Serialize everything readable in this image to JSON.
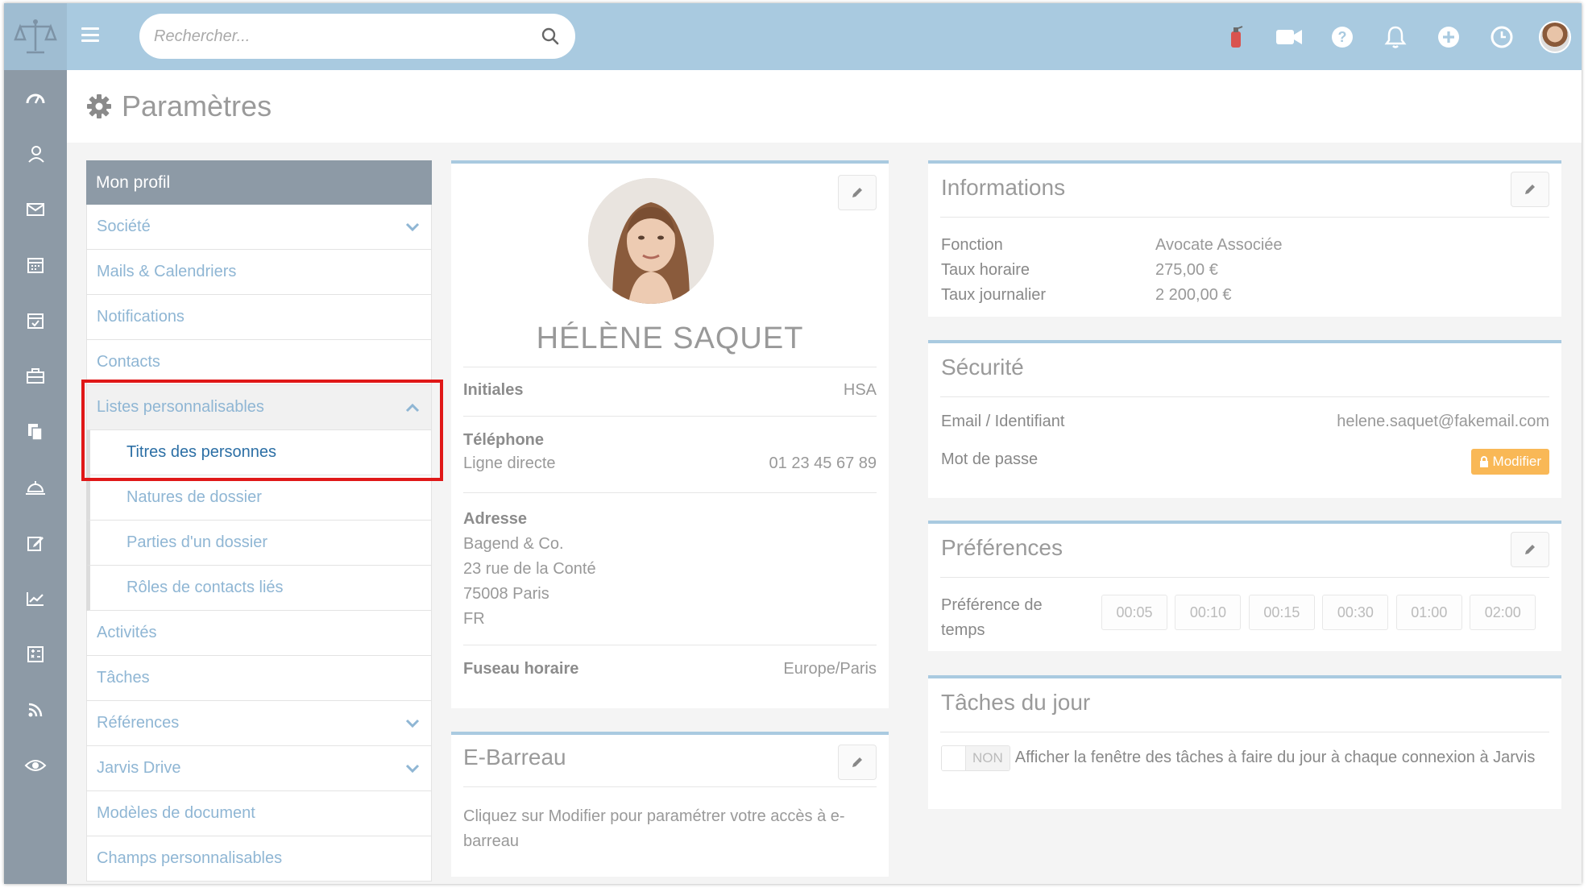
{
  "search": {
    "placeholder": "Rechercher..."
  },
  "page": {
    "title": "Paramètres"
  },
  "menu": {
    "header": "Mon profil",
    "items": [
      {
        "label": "Société",
        "chevron": "down"
      },
      {
        "label": "Mails & Calendriers"
      },
      {
        "label": "Notifications"
      },
      {
        "label": "Contacts"
      },
      {
        "label": "Listes personnalisables",
        "chevron": "up"
      }
    ],
    "subitems": [
      "Titres des personnes",
      "Natures de dossier",
      "Parties d'un dossier",
      "Rôles de contacts liés"
    ],
    "items_after": [
      {
        "label": "Activités"
      },
      {
        "label": "Tâches"
      },
      {
        "label": "Références",
        "chevron": "down"
      },
      {
        "label": "Jarvis Drive",
        "chevron": "down"
      },
      {
        "label": "Modèles de document"
      },
      {
        "label": "Champs personnalisables"
      }
    ]
  },
  "profile": {
    "name": "HÉLÈNE SAQUET",
    "initials_label": "Initiales",
    "initials_value": "HSA",
    "phone_label": "Téléphone",
    "phone_sub_label": "Ligne directe",
    "phone_value": "01 23 45 67 89",
    "address_label": "Adresse",
    "address_lines": [
      "Bagend & Co.",
      "23 rue de la Conté",
      "75008 Paris",
      "FR"
    ],
    "timezone_label": "Fuseau horaire",
    "timezone_value": "Europe/Paris"
  },
  "ebarreau": {
    "title": "E-Barreau",
    "text": "Cliquez sur Modifier pour paramétrer votre accès à e-barreau"
  },
  "informations": {
    "title": "Informations",
    "rows": [
      {
        "label": "Fonction",
        "value": "Avocate Associée"
      },
      {
        "label": "Taux horaire",
        "value": "275,00 €"
      },
      {
        "label": "Taux journalier",
        "value": "2 200,00 €"
      }
    ]
  },
  "securite": {
    "title": "Sécurité",
    "email_label": "Email / Identifiant",
    "email_value": "helene.saquet@fakemail.com",
    "password_label": "Mot de passe",
    "modify_label": "Modifier"
  },
  "preferences": {
    "title": "Préférences",
    "time_label_1": "Préférence de",
    "time_label_2": "temps",
    "times": [
      "00:05",
      "00:10",
      "00:15",
      "00:30",
      "01:00",
      "02:00"
    ]
  },
  "taches": {
    "title": "Tâches du jour",
    "toggle_label": "NON",
    "text": "Afficher la fenêtre des tâches à faire du jour à chaque connexion à Jarvis"
  },
  "colors": {
    "topbar": "#a9cae0",
    "sidebar": "#8d9aa6",
    "link": "#8fb6d4",
    "selected_link": "#2c6fa5",
    "highlight": "#e01818",
    "modify_button": "#f9b856"
  },
  "icons": {
    "logo": "scales-of-justice-icon",
    "top": [
      "extinguisher-icon",
      "video-camera-icon",
      "help-icon",
      "bell-icon",
      "plus-circle-icon",
      "clock-icon"
    ],
    "nav": [
      "dashboard-icon",
      "contacts-icon",
      "mail-icon",
      "calendar-icon",
      "calendar-check-icon",
      "briefcase-icon",
      "documents-icon",
      "bell-service-icon",
      "edit-icon",
      "chart-icon",
      "calculator-icon",
      "rss-icon",
      "eye-icon"
    ]
  }
}
